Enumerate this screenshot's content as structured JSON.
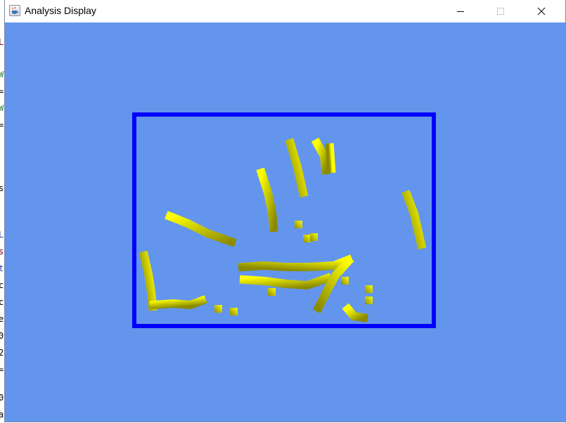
{
  "window": {
    "title": "Analysis Display",
    "background_color": "#6495ed",
    "icon": "java-cup-icon",
    "controls": [
      "minimize-icon",
      "maximize-icon",
      "close-icon"
    ]
  },
  "scene": {
    "frame_color": "#0000ff",
    "trail_colors": [
      "#ffff00",
      "#8b8b00"
    ]
  },
  "background_app": {
    "left_edge_glyphs": [
      "L",
      "W",
      "=",
      "W",
      "=",
      "s",
      "L",
      "s",
      "t",
      "c",
      "c",
      "e",
      "0",
      "2",
      "=",
      "0",
      "a"
    ]
  }
}
